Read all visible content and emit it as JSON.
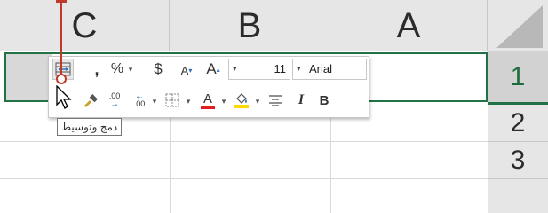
{
  "columns": [
    "C",
    "B",
    "A"
  ],
  "rows": [
    "1",
    "2",
    "3"
  ],
  "mini_toolbar": {
    "font_name": "Arial",
    "font_size": "11",
    "dropdown_arrow": "▾",
    "increase_font": "A",
    "decrease_font": "A",
    "currency": "$",
    "percent": "%",
    "comma": ",",
    "increase_decimal": ".00",
    "decrease_decimal": ".00",
    "bold": "B",
    "italic": "I",
    "font_color_letter": "A",
    "merge_tooltip": "دمج وتوسيط"
  },
  "colors": {
    "accent": "#217346",
    "pointer": "#c0392b",
    "font_color": "#e02020",
    "highlight": "#ffd800"
  }
}
